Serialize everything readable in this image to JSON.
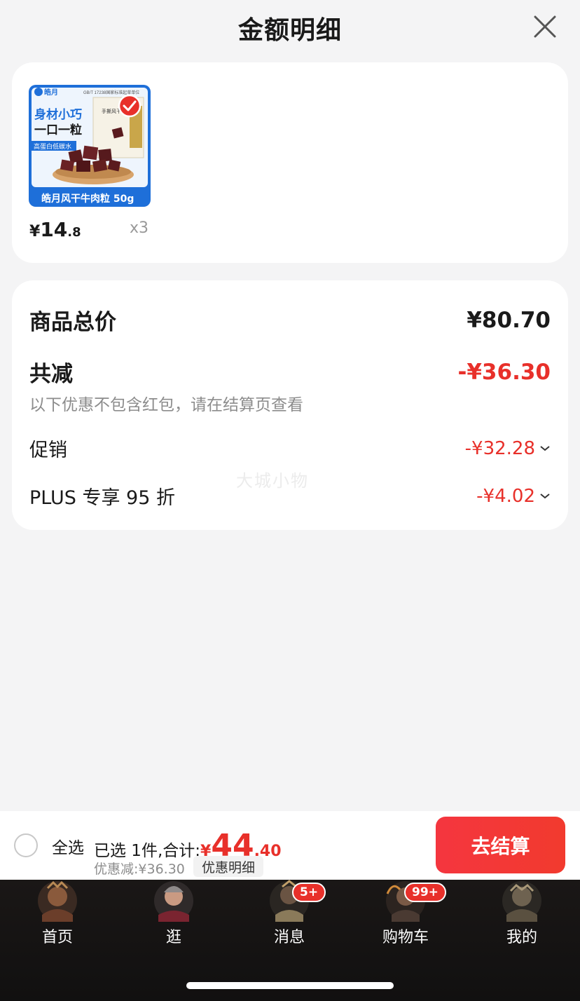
{
  "header": {
    "title": "金额明细"
  },
  "product": {
    "image_texts": {
      "brand": "皓月",
      "standard": "GB/T 17238国家标准起草单位",
      "slogan1": "身材小巧",
      "slogan2": "一口一粒",
      "tag": "高蛋白低碳水",
      "pack": "手撕风干牛",
      "name": "皓月风干牛肉粒 50g"
    },
    "price_currency": "¥",
    "price_int": "14",
    "price_dec": ".8",
    "qty": "x3"
  },
  "summary": {
    "total_label": "商品总价",
    "total_value": "¥80.70",
    "reduce_label": "共减",
    "reduce_value": "-¥36.30",
    "reduce_note": "以下优惠不包含红包，请在结算页查看",
    "promo_label": "促销",
    "promo_value": "-¥32.28",
    "plus_label": "PLUS 专享 95 折",
    "plus_value": "-¥4.02",
    "watermark": "大城小物"
  },
  "checkout": {
    "select_all": "全选",
    "selected_prefix": "已选 1件,合计:",
    "total_currency": "¥",
    "total_int": "44",
    "total_dec": ".40",
    "discount": "优惠减:¥36.30",
    "detail_chip": "优惠明细",
    "button": "去结算"
  },
  "tabs": [
    {
      "label": "首页"
    },
    {
      "label": "逛"
    },
    {
      "label": "消息",
      "badge": "5+"
    },
    {
      "label": "购物车",
      "badge": "99+"
    },
    {
      "label": "我的"
    }
  ],
  "colors": {
    "accent_red": "#e8302a",
    "background": "#f4f4f5",
    "thumb_blue": "#1e6fd9"
  }
}
